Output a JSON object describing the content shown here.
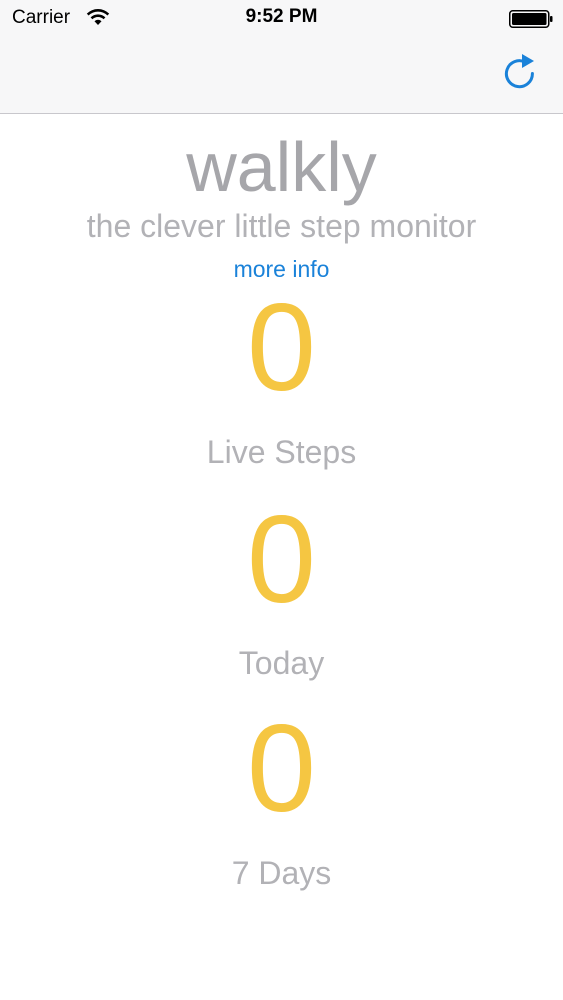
{
  "status_bar": {
    "carrier": "Carrier",
    "time": "9:52 PM"
  },
  "nav_bar": {
    "refresh_icon": "refresh-icon",
    "accent_color": "#1a82d9"
  },
  "header": {
    "title": "walkly",
    "subtitle": "the clever little step monitor",
    "more_info_link": "more info"
  },
  "counters": [
    {
      "value": "0",
      "label": "Live Steps"
    },
    {
      "value": "0",
      "label": "Today"
    },
    {
      "value": "0",
      "label": "7 Days"
    }
  ],
  "colors": {
    "counter_value": "#f5c642",
    "text_gray": "#a6a6aa",
    "link_blue": "#1a82d9"
  }
}
